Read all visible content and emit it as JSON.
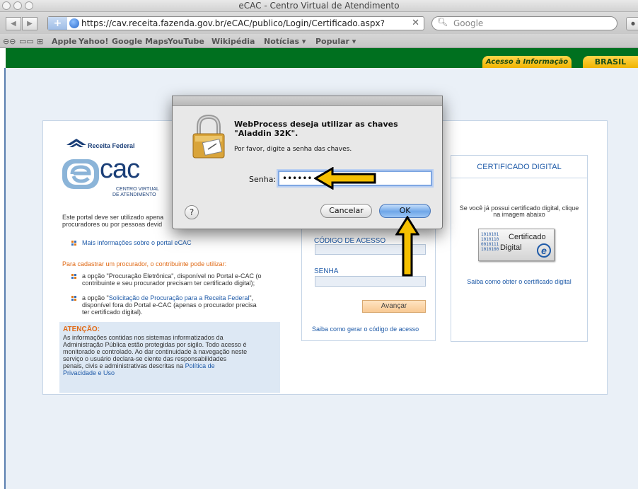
{
  "window": {
    "title": "eCAC - Centro Virtual de Atendimento"
  },
  "toolbar": {
    "url": "https://cav.receita.fazenda.gov.br/eCAC/publico/Login/Certificado.aspx?",
    "search_placeholder": "Google",
    "plus": "+"
  },
  "bookmarks": {
    "items": [
      "Apple",
      "Yahoo!",
      "Google Maps",
      "YouTube",
      "Wikipédia",
      "Notícias ▾",
      "Popular ▾"
    ]
  },
  "gov_bar": {
    "acesso": "Acesso à Informação",
    "brasil": "BRASIL"
  },
  "logo": {
    "receita": "Receita Federal",
    "ecac": "cac",
    "sub1": "CENTRO VIRTUAL",
    "sub2": "DE ATENDIMENTO"
  },
  "left": {
    "intro_line1": "Este portal deve ser utilizado apena",
    "intro_line2": "procuradores ou por pessoas devid",
    "mais_info": "Mais informações sobre o portal eCAC",
    "cadastrar": "Para cadastrar um procurador, o contribuinte pode utilizar:",
    "opt1_line1": "a opção \"Procuração Eletrônica\", disponível no Portal e-CAC (o",
    "opt1_line2": "contribuinte e seu procurador precisam ter certificado digital);",
    "opt2_prefix": "a opção \"",
    "opt2_link": "Solicitação de Procuração para a Receita Federal",
    "opt2_suffix": "\",",
    "opt2_line2": "disponível fora do Portal e-CAC (apenas o procurador precisa",
    "opt2_line3": "ter certificado digital)."
  },
  "atencao": {
    "title": "ATENÇÃO:",
    "line1": "As informações contidas nos sistemas informatizados da",
    "line2": "Administração Pública estão protegidas por sigilo. Todo acesso é",
    "line3": "monitorado e controlado. Ao dar continuidade à navegação neste",
    "line4": "serviço o usuário declara-se ciente das responsabilidades",
    "line5_prefix": "penais, civis e administrativas descritas na ",
    "line5_link": "Política de",
    "line6_link": "Privacidade e Uso"
  },
  "codigo": {
    "codigo_label": "CÓDIGO DE ACESSO",
    "senha_label": "SENHA",
    "avancar": "Avançar",
    "saiba": "Saiba como gerar o código de acesso"
  },
  "certificado": {
    "title": "CERTIFICADO DIGITAL",
    "desc_line1": "Se você já possui certificado digital, clique",
    "desc_line2": "na imagem abaixo",
    "img_word1": "Certificado",
    "img_word2": "Digital",
    "img_e": "e",
    "img_bits": "1010101\n1010110\n0010111\n1010100",
    "saiba": "Saiba como obter o certificado digital"
  },
  "dialog": {
    "title": "WebProcess deseja utilizar as chaves \"Aladdin 32K\".",
    "message": "Por favor, digite a senha das chaves.",
    "senha_label": "Senha:",
    "senha_value": "••••••",
    "help": "?",
    "cancel": "Cancelar",
    "ok": "OK"
  },
  "colors": {
    "arrow_fill": "#f5c000",
    "gov_green": "#00701f",
    "link_blue": "#1e5aa8",
    "orange": "#e06a16"
  }
}
